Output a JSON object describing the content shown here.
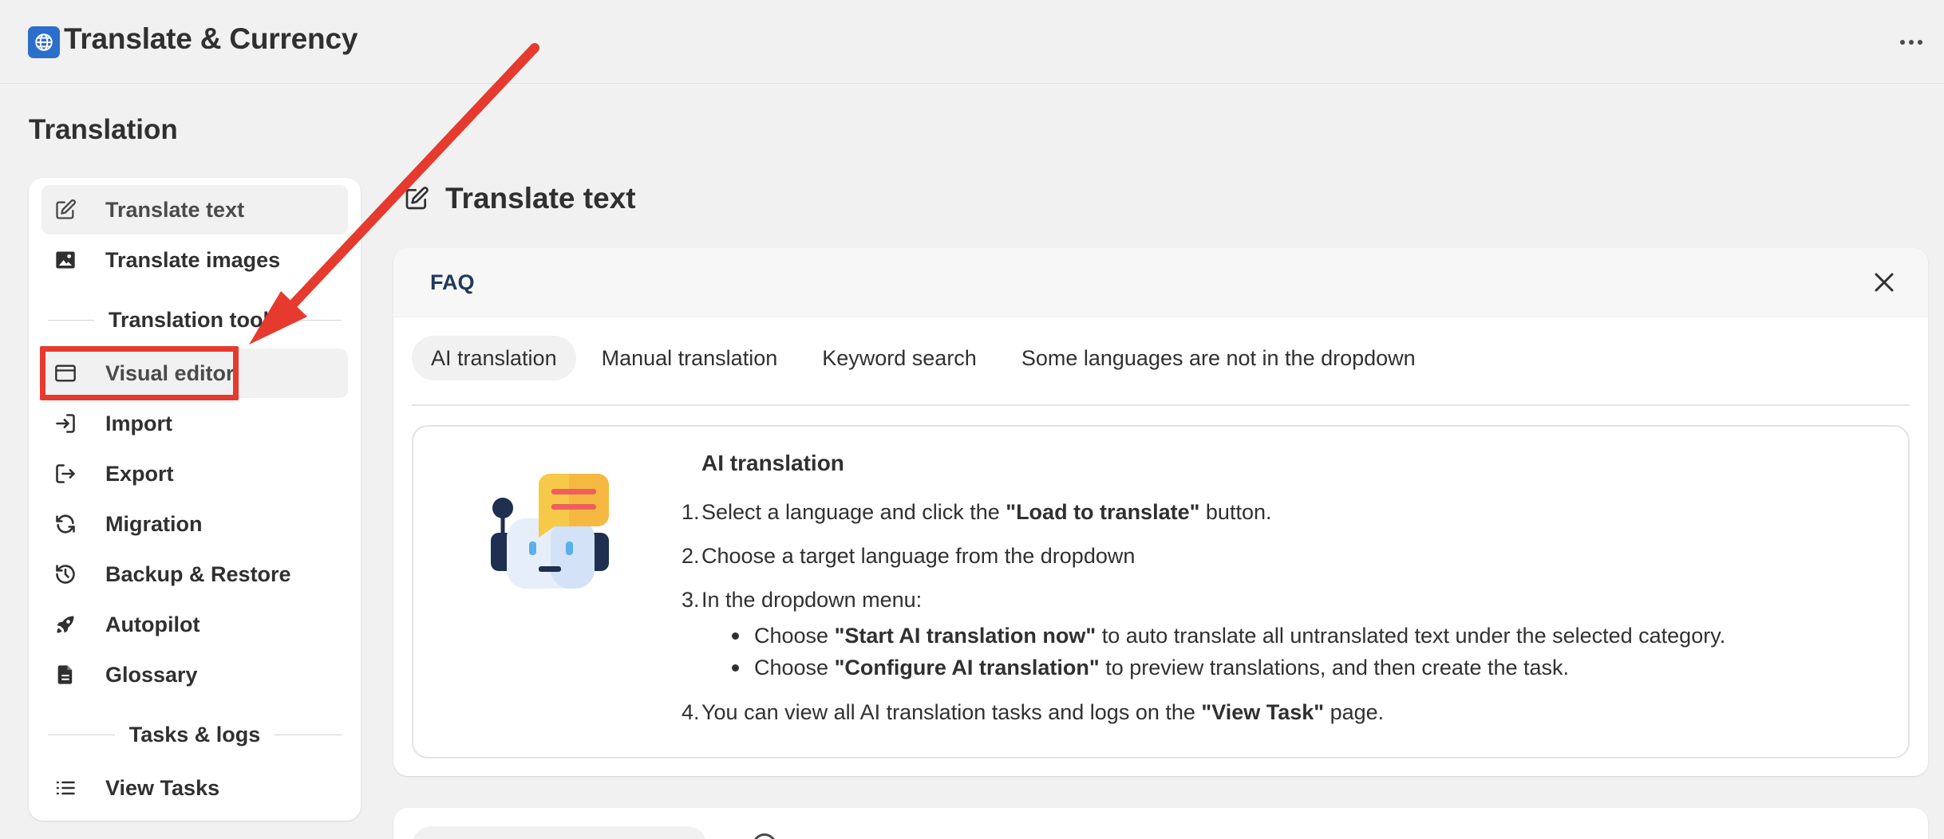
{
  "app": {
    "title": "Translate & Currency",
    "icon": "globe-icon",
    "accent_color": "#2c6ecb"
  },
  "page": {
    "heading": "Translation"
  },
  "sidebar": {
    "items": [
      {
        "label": "Translate text",
        "icon": "edit-icon",
        "active": true
      },
      {
        "label": "Translate images",
        "icon": "image-icon"
      }
    ],
    "section_tools": "Translation tools",
    "tool_items": [
      {
        "label": "Visual editor",
        "icon": "browser-window-icon"
      },
      {
        "label": "Import",
        "icon": "import-icon"
      },
      {
        "label": "Export",
        "icon": "export-icon"
      },
      {
        "label": "Migration",
        "icon": "refresh-icon"
      },
      {
        "label": "Backup & Restore",
        "icon": "history-icon"
      },
      {
        "label": "Autopilot",
        "icon": "rocket-icon"
      },
      {
        "label": "Glossary",
        "icon": "document-icon"
      }
    ],
    "section_tasks": "Tasks & logs",
    "task_items": [
      {
        "label": "View Tasks",
        "icon": "list-icon"
      }
    ]
  },
  "main": {
    "title": "Translate text",
    "faq": {
      "title": "FAQ",
      "tabs": [
        {
          "label": "AI translation",
          "active": true
        },
        {
          "label": "Manual translation"
        },
        {
          "label": "Keyword search"
        },
        {
          "label": "Some languages are not in the dropdown"
        }
      ],
      "content": {
        "title": "AI translation",
        "step1_num": "1.",
        "step1_pre": "Select a language and click the ",
        "step1_bold": "\"Load to translate\"",
        "step1_post": " button.",
        "step2_num": "2.",
        "step2": "Choose a target language from the dropdown",
        "step3_num": "3.",
        "step3": "In the dropdown menu:",
        "sub1_pre": "Choose ",
        "sub1_bold": "\"Start AI translation now\"",
        "sub1_post": " to auto translate all untranslated text under the selected category.",
        "sub2_pre": "Choose ",
        "sub2_bold": "\"Configure AI translation\"",
        "sub2_post": " to preview translations, and then create the task.",
        "step4_num": "4.",
        "step4_pre": "You can view all AI translation tasks and logs on the ",
        "step4_bold": "\"View Task\"",
        "step4_post": " page."
      }
    }
  },
  "annotation": {
    "highlight_color": "#e63a2e"
  }
}
